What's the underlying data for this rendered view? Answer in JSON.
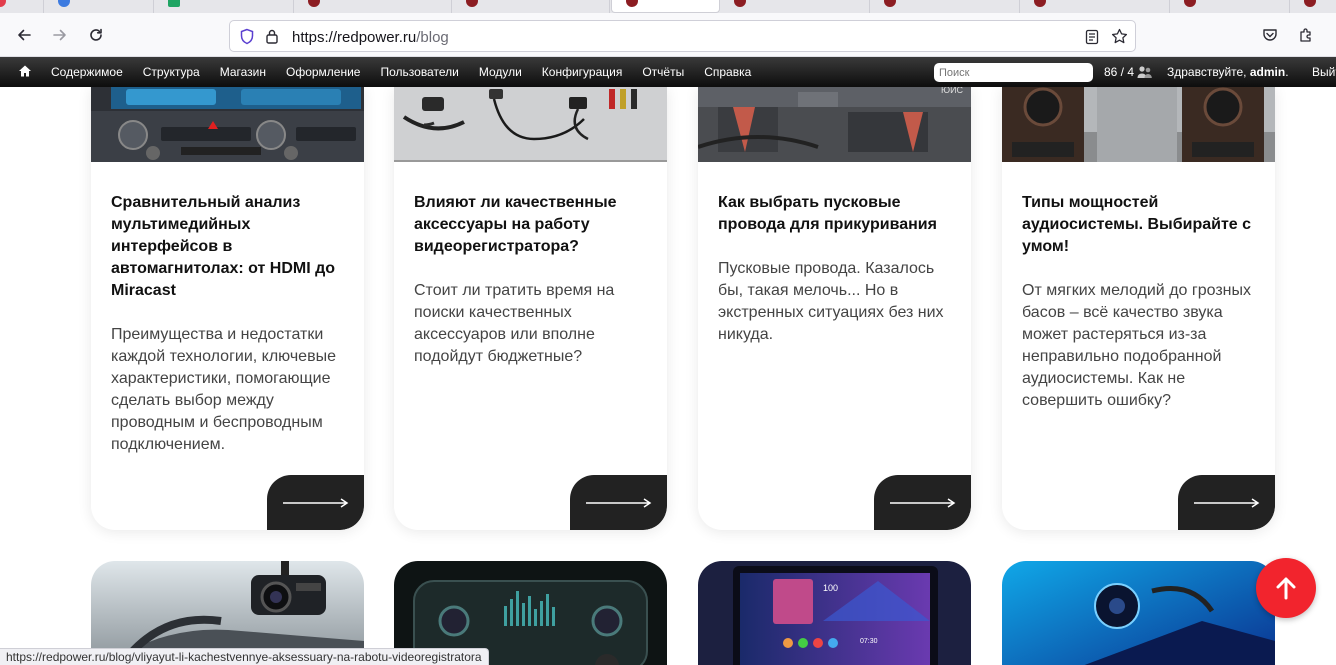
{
  "browser": {
    "url_host": "https://redpower.ru",
    "url_path": "/blog"
  },
  "admin_toolbar": {
    "menu": [
      "Содержимое",
      "Структура",
      "Магазин",
      "Оформление",
      "Пользователи",
      "Модули",
      "Конфигурация",
      "Отчёты",
      "Справка"
    ],
    "search_placeholder": "Поиск",
    "counter": "86 / 4",
    "greeting": "Здравствуйте, ",
    "username": "admin",
    "greeting_end": ".",
    "exit": "Выйти"
  },
  "cards": [
    {
      "title": "Сравнительный анализ мультимедийных интерфейсов в автомагнитолах: от HDMI до Miracast",
      "description": "Преимущества и недостатки каждой технологии, ключевые характеристики, помогающие сделать выбор между проводным и беспроводным подключением."
    },
    {
      "title": "Влияют ли качественные аксессуары на работу видеорегистратора?",
      "description": "Стоит ли тратить время на поиски качественных аксессуаров или вполне подойдут бюджетные?"
    },
    {
      "title": "Как выбрать пусковые провода для прикуривания",
      "description": "Пусковые провода. Казалось бы, такая мелочь... Но в экстренных ситуациях без них никуда."
    },
    {
      "title": "Типы мощностей аудиосистемы. Выбирайте с умом!",
      "description": "От мягких мелодий до грозных басов – всё качество звука может растеряться из-за неправильно подобранной аудиосистемы. Как не совершить ошибку?"
    }
  ],
  "image_texts": {
    "car_display": "100",
    "car_clock": "07:30",
    "card3_caption": "ЮИС"
  },
  "status_url": "https://redpower.ru/blog/vliyayut-li-kachestvennye-aksessuary-na-rabotu-videoregistratora",
  "colors": {
    "accent": "#f2242d",
    "toolbar": "#1a1a1a",
    "button_dark": "#222222"
  }
}
